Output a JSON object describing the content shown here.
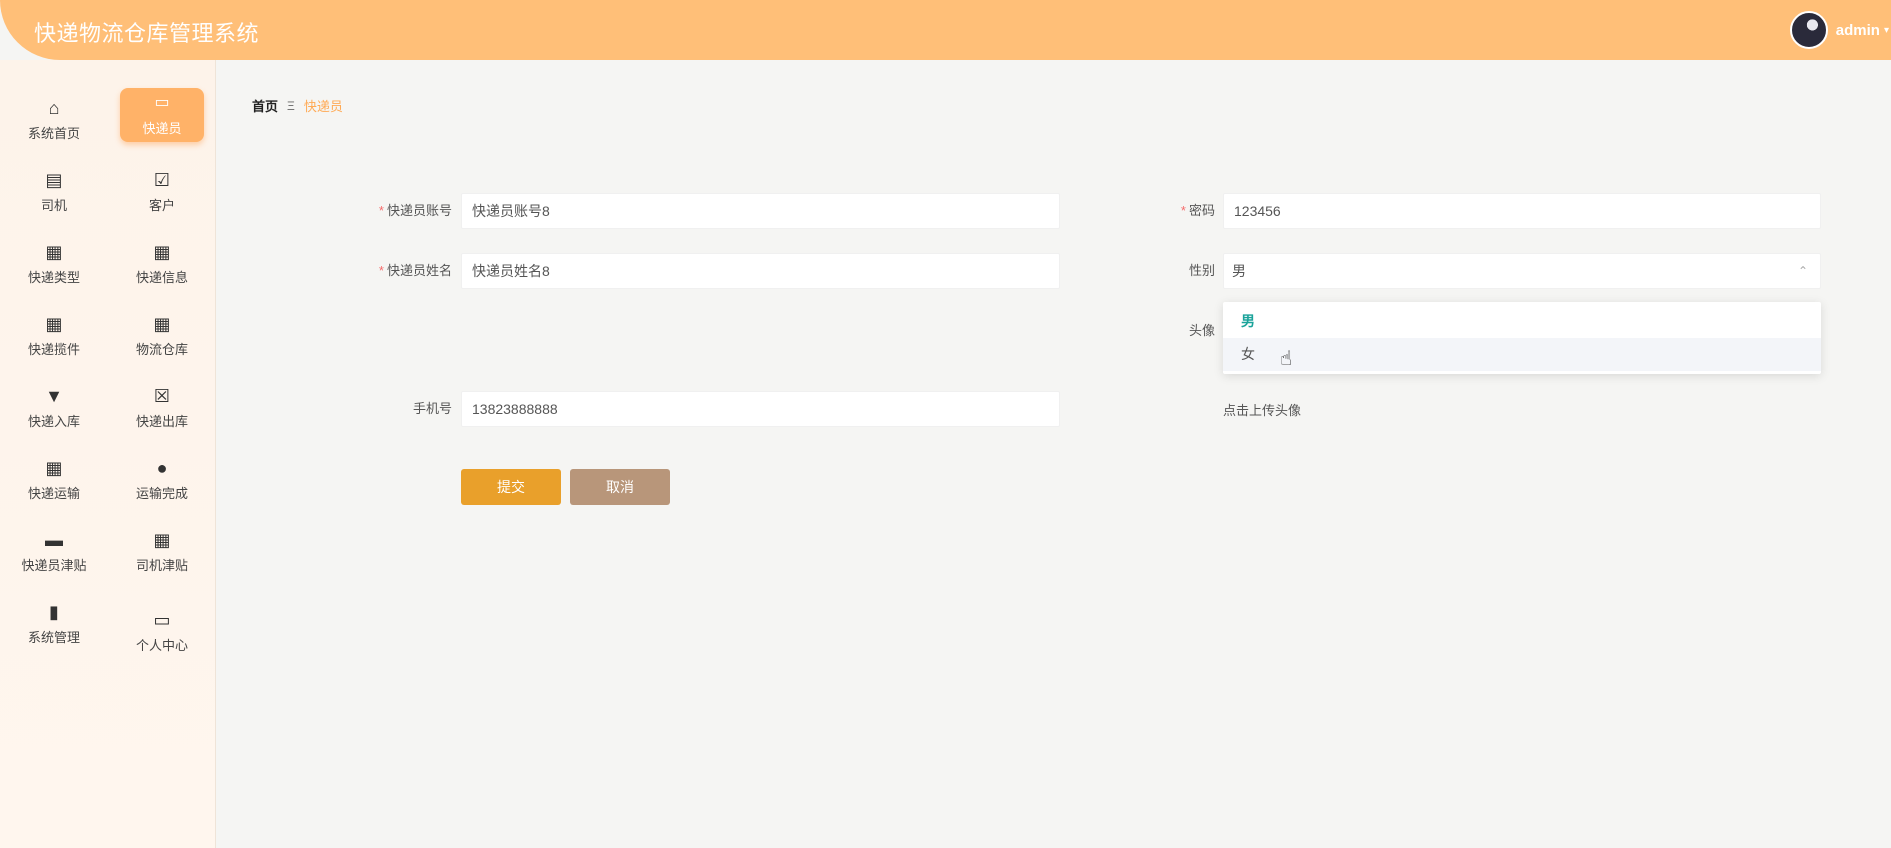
{
  "header": {
    "title": "快递物流仓库管理系统",
    "username": "admin",
    "caret": "▾"
  },
  "sidebar": {
    "items": [
      {
        "label": "系统首页",
        "icon": "home-icon",
        "glyph": "⌂"
      },
      {
        "label": "快递员",
        "icon": "chart-icon",
        "glyph": "▭",
        "active": true
      },
      {
        "label": "司机",
        "icon": "clipboard-icon",
        "glyph": "▤"
      },
      {
        "label": "客户",
        "icon": "clipboard-check-icon",
        "glyph": "☑"
      },
      {
        "label": "快递类型",
        "icon": "grid-icon",
        "glyph": "▦"
      },
      {
        "label": "快递信息",
        "icon": "grid-icon",
        "glyph": "▦"
      },
      {
        "label": "快递揽件",
        "icon": "grid-icon",
        "glyph": "▦"
      },
      {
        "label": "物流仓库",
        "icon": "grid-icon",
        "glyph": "▦"
      },
      {
        "label": "快递入库",
        "icon": "brush-icon",
        "glyph": "▼"
      },
      {
        "label": "快递出库",
        "icon": "clipboard-x-icon",
        "glyph": "☒"
      },
      {
        "label": "快递运输",
        "icon": "grid-icon",
        "glyph": "▦"
      },
      {
        "label": "运输完成",
        "icon": "user-icon",
        "glyph": "●"
      },
      {
        "label": "快递员津贴",
        "icon": "briefcase-icon",
        "glyph": "▬"
      },
      {
        "label": "司机津贴",
        "icon": "grid-icon",
        "glyph": "▦"
      },
      {
        "label": "系统管理",
        "icon": "book-icon",
        "glyph": "▮"
      },
      {
        "label": "个人中心",
        "icon": "wallet-icon",
        "glyph": "▭"
      }
    ]
  },
  "breadcrumb": {
    "home": "首页",
    "separator": "Ξ",
    "current": "快递员"
  },
  "form": {
    "required_mark": "*",
    "account": {
      "label": "快递员账号",
      "value": "快递员账号8"
    },
    "password": {
      "label": "密码",
      "value": "123456"
    },
    "name": {
      "label": "快递员姓名",
      "value": "快递员姓名8"
    },
    "gender": {
      "label": "性别",
      "value": "男",
      "arrow": "⌃",
      "options": [
        "男",
        "女"
      ]
    },
    "avatar": {
      "label": "头像",
      "upload_text": "点击上传头像"
    },
    "phone": {
      "label": "手机号",
      "value": "13823888888"
    },
    "submit_label": "提交",
    "cancel_label": "取消"
  },
  "colors": {
    "header": "#ffbf78",
    "accent": "#ffb268",
    "submit": "#e9a02b",
    "cancel": "#b8967a",
    "selected_option": "#1aa39a"
  }
}
